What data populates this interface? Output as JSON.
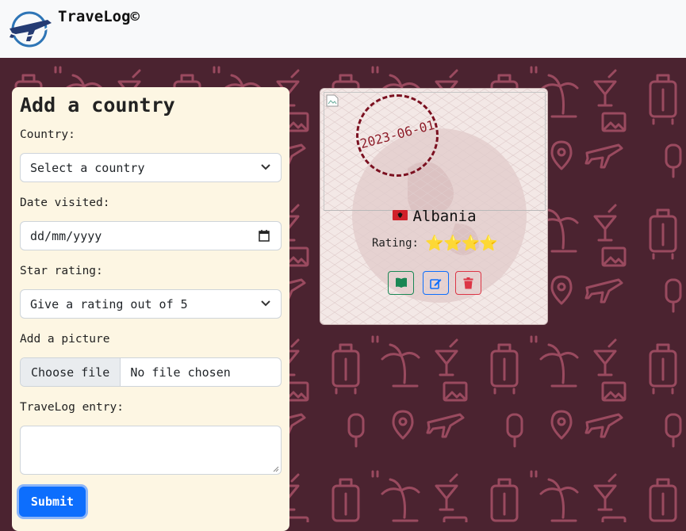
{
  "navbar": {
    "brand": "TraveLog©",
    "logo_icon": "airplane-globe-icon"
  },
  "form": {
    "title": "Add a country",
    "country": {
      "label": "Country:",
      "value": "Select a country"
    },
    "date": {
      "label": "Date visited:",
      "placeholder": "dd/mm/yyyy"
    },
    "rating": {
      "label": "Star rating:",
      "value": "Give a rating out of 5"
    },
    "picture": {
      "label": "Add a picture",
      "button": "Choose file",
      "status": "No file chosen"
    },
    "entry": {
      "label": "TraveLog entry:",
      "value": ""
    },
    "submit_label": "Submit"
  },
  "card": {
    "date": "2023-06-01",
    "country": "Albania",
    "flag_icon": "albania-flag-icon",
    "rating_label": "Rating:",
    "rating_value": 4,
    "rating_stars": "⭐⭐⭐⭐",
    "actions": [
      "book-icon",
      "edit-icon",
      "trash-icon"
    ]
  },
  "colors": {
    "background": "#4b2330",
    "pattern": "#9a4a5f",
    "panel": "#fdf6e3",
    "submit": "#0d6efd",
    "read": "#198754",
    "edit": "#0d6efd",
    "delete": "#dc3545",
    "stamp": "#7b1020"
  }
}
